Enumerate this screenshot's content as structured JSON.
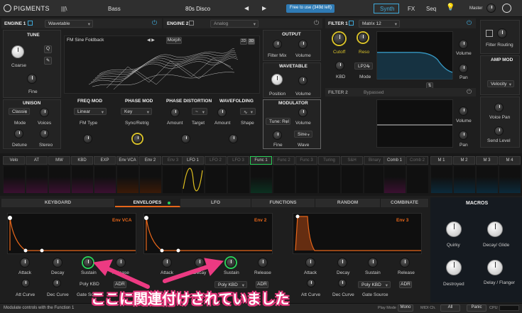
{
  "topbar": {
    "logo": "PIGMENTS",
    "browser_icon": "|||\\",
    "preset_type": "Bass",
    "preset_name": "80s Disco",
    "prev": "◀",
    "next": "▶",
    "trial": "Free to use (349d left)",
    "tabs": [
      "Synth",
      "FX",
      "Seq"
    ],
    "master": "Master"
  },
  "engine1": {
    "title": "ENGINE 1",
    "type": "Wavetable",
    "tune_title": "TUNE",
    "coarse": "Coarse",
    "fine": "Fine",
    "q_btn": "Q",
    "unison_title": "UNISON",
    "unison_mode_val": "Classic",
    "mode": "Mode",
    "voices": "Voices",
    "detune": "Detune",
    "stereo": "Stereo",
    "wt_name": "FM Sine Foldback",
    "morph": "Morph",
    "btn_2d": "2D",
    "btn_3d": "3D",
    "freq_mod": "FREQ MOD",
    "freq_mod_val": "Linear",
    "fm_type": "FM Type",
    "phase_mod": "PHASE MOD",
    "phase_mod_val": "Key",
    "sync_retrig": "Sync/Retrig",
    "phase_dist": "PHASE DISTORTION",
    "amount": "Amount",
    "target": "Target",
    "wavefolding": "WAVEFOLDING",
    "amount2": "Amount",
    "shape": "Shape",
    "output_title": "OUTPUT",
    "filter_mix": "Filter Mix",
    "volume": "Volume",
    "wavetable_title": "WAVETABLE",
    "position": "Position",
    "volume2": "Volume",
    "modulator_title": "MODULATOR",
    "tune_rel": "Tune: Rel",
    "volume3": "Volume",
    "fine2": "Fine",
    "sine": "Sine",
    "wave": "Wave"
  },
  "engine2": {
    "title": "ENGINE 2",
    "type": "Analog"
  },
  "filter1": {
    "title": "FILTER 1",
    "type": "Matrix 12",
    "cutoff": "Cutoff",
    "reso": "Reso",
    "kbd": "KBD",
    "lp24": "LP24",
    "mode": "Mode",
    "volume": "Volume",
    "pan": "Pan"
  },
  "filter2": {
    "title": "FILTER 2",
    "bypassed": "Bypassed",
    "volume": "Volume",
    "pan": "Pan"
  },
  "routing": {
    "filter_routing": "Filter Routing",
    "amp_mod": "AMP MOD",
    "velocity": "Velocity",
    "voice_pan": "Voice Pan",
    "send_level": "Send Level"
  },
  "modstrip": [
    "Velo",
    "AT",
    "MW",
    "KBD",
    "EXP",
    "Env VCA",
    "Env 2",
    "Env 3",
    "LFO 1",
    "LFO 2",
    "LFO 3",
    "Func 1",
    "Func 2",
    "Func 3",
    "Turing",
    "S&H",
    "Binary",
    "Comb 1",
    "Comb 2",
    "M 1",
    "M 2",
    "M 3",
    "M 4"
  ],
  "bottom_tabs": [
    "KEYBOARD",
    "ENVELOPES",
    "LFO",
    "FUNCTIONS",
    "RANDOM",
    "COMBINATE"
  ],
  "env_vca": {
    "title": "Env VCA",
    "attack": "Attack",
    "decay": "Decay",
    "sustain": "Sustain",
    "release": "Release",
    "att_curve": "Att Curve",
    "dec_curve": "Dec Curve",
    "poly_kbd": "Poly KBD",
    "gate_source": "Gate Source",
    "adr": "ADR"
  },
  "env2": {
    "title": "Env 2",
    "attack": "Attack",
    "decay": "Decay",
    "sustain": "Sustain",
    "release": "Release",
    "poly_kbd": "Poly KBD",
    "adr": "ADR"
  },
  "env3": {
    "title": "Env 3",
    "attack": "Attack",
    "decay": "Decay",
    "sustain": "Sustain",
    "release": "Release",
    "att_curve": "Att Curve",
    "dec_curve": "Dec Curve",
    "poly_kbd": "Poly KBD",
    "gate_source": "Gate Source",
    "adr": "ADR"
  },
  "macros": {
    "title": "MACROS",
    "items": [
      "Quirky",
      "Decay/ Glide",
      "Destroyed",
      "Delay / Flanger"
    ]
  },
  "status": {
    "hint": "Modulate controls with the Function 1",
    "play_mode": "Play Mode",
    "mono": "Mono",
    "midi_ch": "MIDI Ch.",
    "all": "All",
    "panic": "Panic",
    "cpu": "CPU"
  },
  "annotation": "ここに関連付けされていました"
}
